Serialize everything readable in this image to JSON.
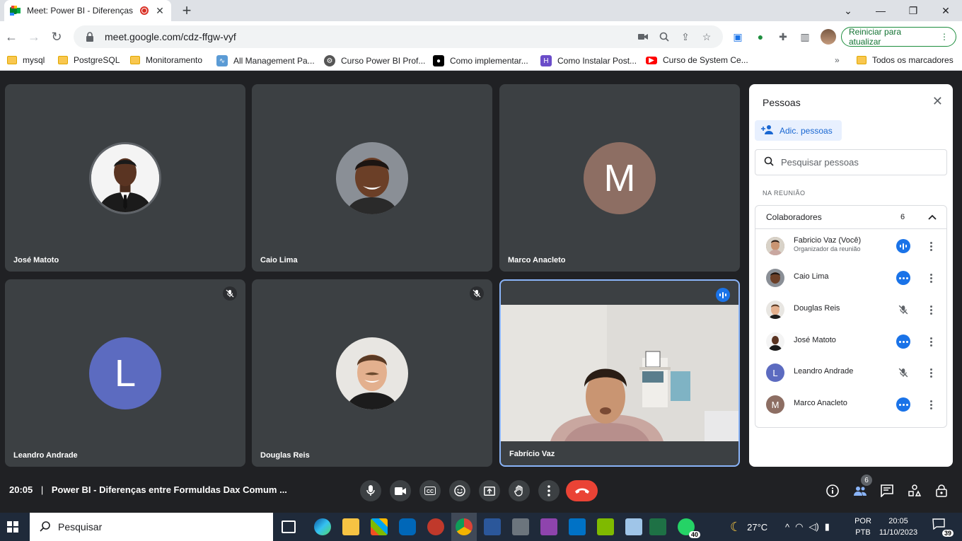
{
  "browser": {
    "tab_title": "Meet: Power BI - Diferenças",
    "url": "meet.google.com/cdz-ffgw-vyf",
    "update_button": "Reiniciar para atualizar",
    "bookmarks": [
      "mysql",
      "PostgreSQL",
      "Monitoramento",
      "All Management Pa...",
      "Curso Power BI Prof...",
      "Como implementar...",
      "Como Instalar Post...",
      "Curso de System Ce..."
    ],
    "bookmarks_all": "Todos os marcadores"
  },
  "tiles": [
    {
      "name": "José Matoto",
      "avatar": "photo"
    },
    {
      "name": "Caio Lima",
      "avatar": "photo"
    },
    {
      "name": "Marco Anacleto",
      "avatar_letter": "M",
      "color": "#8d6e63"
    },
    {
      "name": "Leandro Andrade",
      "avatar_letter": "L",
      "color": "#5c6bc0",
      "muted": true
    },
    {
      "name": "Douglas Reis",
      "avatar": "photo",
      "muted": true
    },
    {
      "name": "Fabrício Vaz",
      "avatar": "video",
      "speaking": true
    }
  ],
  "panel": {
    "title": "Pessoas",
    "add_label": "Adic. pessoas",
    "search_placeholder": "Pesquisar pessoas",
    "section": "NA REUNIÃO",
    "group_label": "Colaboradores",
    "group_count": "6",
    "people": [
      {
        "name": "Fabricio Vaz (Você)",
        "subtitle": "Organizador da reunião",
        "status": "speaking"
      },
      {
        "name": "Caio Lima",
        "status": "more"
      },
      {
        "name": "Douglas Reis",
        "status": "muted"
      },
      {
        "name": "José Matoto",
        "status": "more"
      },
      {
        "name": "Leandro Andrade",
        "letter": "L",
        "status": "muted"
      },
      {
        "name": "Marco Anacleto",
        "letter": "M",
        "status": "more"
      }
    ]
  },
  "meeting": {
    "time": "20:05",
    "title": "Power BI - Diferenças entre Formuldas Dax Comum ...",
    "people_count": "6"
  },
  "taskbar": {
    "search_placeholder": "Pesquisar",
    "whatsapp_badge": "40",
    "weather": "27°C",
    "lang_line1": "POR",
    "lang_line2": "PTB",
    "time": "20:05",
    "date": "11/10/2023",
    "notifications": "39"
  },
  "colors": {
    "accent": "#1a73e8",
    "hangup": "#ea4335",
    "tile_bg": "#3c4043",
    "meet_bg": "#202124"
  }
}
